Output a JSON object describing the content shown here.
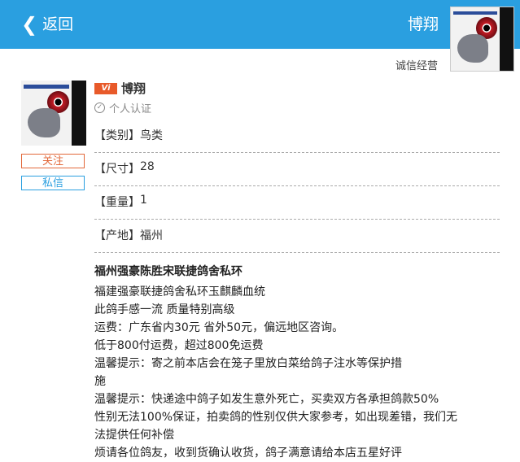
{
  "header": {
    "back_label": "返回",
    "back_icon": "chevron-left-icon",
    "shop_name": "博翔"
  },
  "store": {
    "label": "诚信经营"
  },
  "seller": {
    "badge": "Vi",
    "name": "博翔",
    "cert_label": "个人认证"
  },
  "actions": {
    "follow_label": "关注",
    "message_label": "私信"
  },
  "attributes": [
    {
      "key": "【类别】",
      "value": "鸟类"
    },
    {
      "key": "【尺寸】",
      "value": "28"
    },
    {
      "key": "【重量】",
      "value": "1"
    },
    {
      "key": "【产地】",
      "value": "福州"
    }
  ],
  "product": {
    "title": "福州强豪陈胜宋联捷鸽舍私环",
    "lines": [
      "福建强豪联捷鸽舍私环玉麒麟血统",
      "此鸽手感一流 质量特别高级",
      "运费：广东省内30元 省外50元，偏远地区咨询。",
      "低于800付运费，超过800免运费",
      "温馨提示：寄之前本店会在笼子里放白菜给鸽子注水等保护措",
      "施",
      "温馨提示：快递途中鸽子如发生意外死亡，买卖双方各承担鸽款50%",
      "性别无法100%保证，拍卖鸽的性别仅供大家参考，如出现差错，我们无",
      "法提供任何补偿",
      "烦请各位鸽友，收到货确认收货，鸽子满意请给本店五星好评"
    ]
  },
  "colors": {
    "header": "#2a9fe0",
    "follow": "#e2683a",
    "badge": "#e85a2a"
  }
}
